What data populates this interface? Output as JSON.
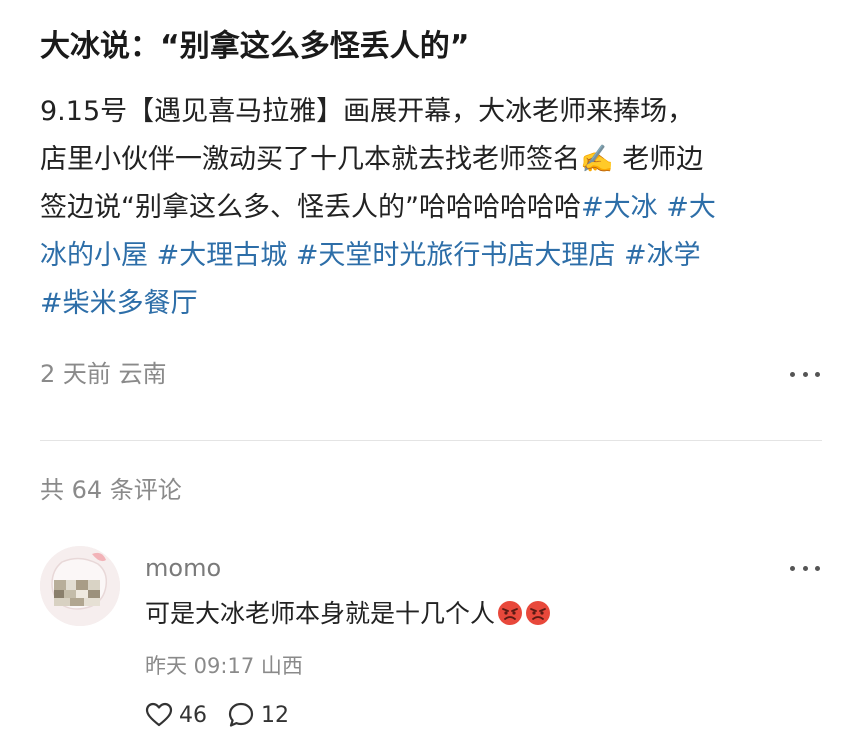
{
  "post": {
    "title": "大冰说：“别拿这么多怪丢人的”",
    "body_lines": [
      [
        {
          "text": "9.15号【遇见喜马拉雅】画展开幕，大冰老师来捧场，",
          "tag": false
        }
      ],
      [
        {
          "text": "店里小伙伴一激动买了十几本就去找老师签名✍️ 老师边",
          "tag": false
        }
      ],
      [
        {
          "text": "签边说“别拿这么多、怪丢人的”哈哈哈哈哈哈",
          "tag": false
        },
        {
          "text": "#大冰",
          "tag": true
        },
        {
          "text": " ",
          "tag": false
        },
        {
          "text": "#大",
          "tag": true
        }
      ],
      [
        {
          "text": "冰的小屋",
          "tag": true
        },
        {
          "text": " ",
          "tag": false
        },
        {
          "text": "#大理古城",
          "tag": true
        },
        {
          "text": " ",
          "tag": false
        },
        {
          "text": "#天堂时光旅行书店大理店",
          "tag": true
        },
        {
          "text": " ",
          "tag": false
        },
        {
          "text": "#冰学",
          "tag": true
        }
      ],
      [
        {
          "text": "#柴米多餐厅",
          "tag": true
        }
      ]
    ],
    "meta": "2 天前  云南",
    "tag_color": "#2d6ea8"
  },
  "comments": {
    "count_label": "共 64 条评论",
    "items": [
      {
        "username": "momo",
        "text": "可是大冰老师本身就是十几个人",
        "emojis": [
          "angry-face-icon",
          "angry-face-icon"
        ],
        "meta": "昨天 09:17 山西",
        "likes": "46",
        "replies": "12"
      }
    ]
  }
}
